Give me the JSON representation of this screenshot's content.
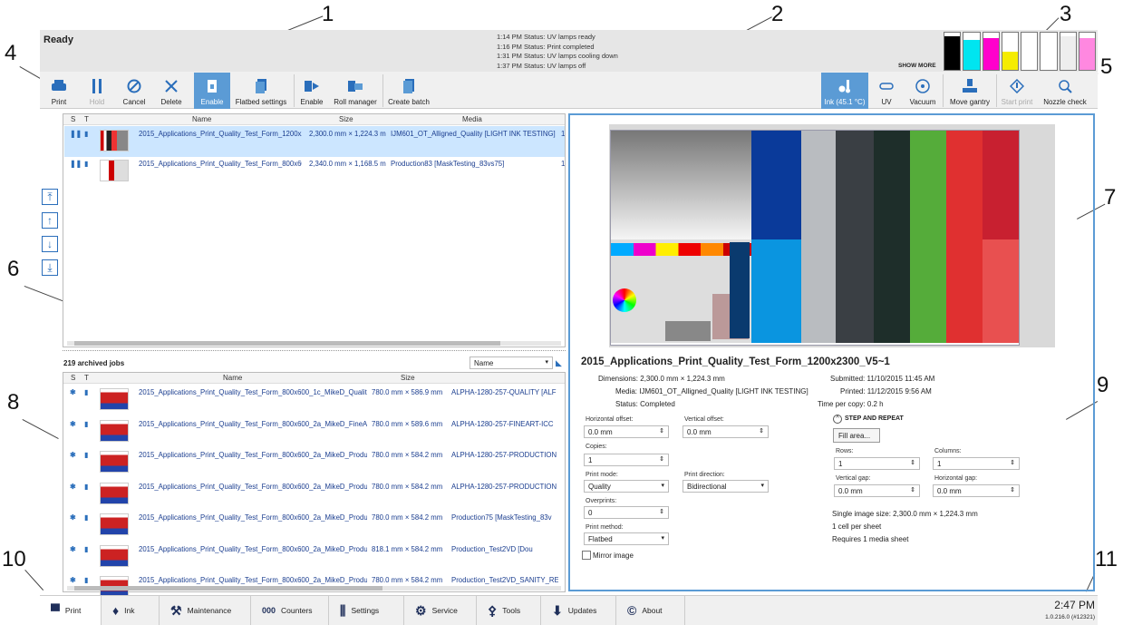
{
  "callouts": [
    "1",
    "2",
    "3",
    "4",
    "5",
    "6",
    "7",
    "8",
    "9",
    "10",
    "11"
  ],
  "status": {
    "ready": "Ready",
    "messages": [
      "1:14 PM Status: UV lamps ready",
      "1:16 PM Status: Print completed",
      "1:31 PM Status: UV lamps cooling down",
      "1:37 PM Status: UV lamps off"
    ],
    "show_more": "SHOW MORE"
  },
  "inks": [
    {
      "color": "#000000",
      "level": 0.9
    },
    {
      "color": "#00e5f0",
      "level": 0.8
    },
    {
      "color": "#ff00cc",
      "level": 0.85
    },
    {
      "color": "#f5ec00",
      "level": 0.5
    },
    {
      "color": "#ffffff",
      "level": 0.95
    },
    {
      "color": "#ffffff",
      "level": 0.95
    },
    {
      "color": "#eeeeee",
      "level": 0.9
    },
    {
      "color": "#ff88e0",
      "level": 0.85
    }
  ],
  "toolbar": {
    "print": "Print",
    "hold": "Hold",
    "cancel": "Cancel",
    "delete": "Delete",
    "enable": "Enable",
    "flatbed": "Flatbed settings",
    "enable2": "Enable",
    "roll": "Roll manager",
    "batch": "Create batch",
    "ink": "Ink (45.1 °C)",
    "uv": "UV",
    "vacuum": "Vacuum",
    "gantry": "Move gantry",
    "start": "Start print",
    "nozzle": "Nozzle check"
  },
  "queue": {
    "headers": [
      "S",
      "T",
      "Name",
      "Size",
      "Media"
    ],
    "rows": [
      {
        "name": "2015_Applications_Print_Quality_Test_Form_1200x2",
        "size": "2,300.0 mm × 1,224.3 m",
        "media": "IJM601_OT_Alligned_Quality [LIGHT INK TESTING]",
        "extra": "1"
      },
      {
        "name": "2015_Applications_Print_Quality_Test_Form_800x60",
        "size": "2,340.0 mm × 1,168.5 m",
        "media": "Production83 [MaskTesting_83vs75]",
        "extra": "1"
      }
    ]
  },
  "archive": {
    "count": "219 archived jobs",
    "sort": "Name",
    "headers": [
      "S",
      "T",
      "Name",
      "Size"
    ],
    "rows": [
      {
        "name": "2015_Applications_Print_Quality_Test_Form_800x600_1c_MikeD_Qualit",
        "size": "780.0 mm × 586.9 mm",
        "media": "ALPHA-1280-257-QUALITY [ALF"
      },
      {
        "name": "2015_Applications_Print_Quality_Test_Form_800x600_2a_MikeD_FineA",
        "size": "780.0 mm × 589.6 mm",
        "media": "ALPHA-1280-257-FINEART-ICC"
      },
      {
        "name": "2015_Applications_Print_Quality_Test_Form_800x600_2a_MikeD_Produ",
        "size": "780.0 mm × 584.2 mm",
        "media": "ALPHA-1280-257-PRODUCTION"
      },
      {
        "name": "2015_Applications_Print_Quality_Test_Form_800x600_2a_MikeD_Produ",
        "size": "780.0 mm × 584.2 mm",
        "media": "ALPHA-1280-257-PRODUCTION"
      },
      {
        "name": "2015_Applications_Print_Quality_Test_Form_800x600_2a_MikeD_Produ",
        "size": "780.0 mm × 584.2 mm",
        "media": "Production75 [MaskTesting_83v"
      },
      {
        "name": "2015_Applications_Print_Quality_Test_Form_800x600_2a_MikeD_Produ",
        "size": "818.1 mm × 584.2 mm",
        "media": "Production_Test2VD [Dou"
      },
      {
        "name": "2015_Applications_Print_Quality_Test_Form_800x600_2a_MikeD_Produ",
        "size": "780.0 mm × 584.2 mm",
        "media": "Production_Test2VD_SANITY_RE"
      }
    ]
  },
  "detail": {
    "title": "2015_Applications_Print_Quality_Test_Form_1200x2300_V5~1",
    "dimensions": "Dimensions: 2,300.0 mm × 1,224.3 mm",
    "media": "Media: IJM601_OT_Alligned_Quality [LIGHT INK TESTING]",
    "status": "Status: Completed",
    "submitted": "Submitted: 11/10/2015 11:45 AM",
    "printed": "Printed: 11/12/2015 9:56 AM",
    "time": "Time per copy: 0.2 h",
    "h_offset_label": "Horizontal offset:",
    "h_offset": "0.0 mm",
    "v_offset_label": "Vertical offset:",
    "v_offset": "0.0 mm",
    "copies_label": "Copies:",
    "copies": "1",
    "mode_label": "Print mode:",
    "mode": "Quality",
    "dir_label": "Print direction:",
    "dir": "Bidirectional",
    "over_label": "Overprints:",
    "over": "0",
    "method_label": "Print method:",
    "method": "Flatbed",
    "mirror": "Mirror image",
    "step": "STEP AND REPEAT",
    "fill": "Fill area...",
    "rows_label": "Rows:",
    "rows": "1",
    "cols_label": "Columns:",
    "cols": "1",
    "vgap_label": "Vertical gap:",
    "vgap": "0.0 mm",
    "hgap_label": "Horizontal gap:",
    "hgap": "0.0 mm",
    "single": "Single image size: 2,300.0 mm × 1,224.3 mm",
    "cell": "1 cell per sheet",
    "req": "Requires 1 media sheet"
  },
  "tabs": [
    "Print",
    "Ink",
    "Maintenance",
    "Counters",
    "Settings",
    "Service",
    "Tools",
    "Updates",
    "About"
  ],
  "clock": {
    "time": "2:47 PM",
    "version": "1.0.216.0 (#12321)"
  }
}
